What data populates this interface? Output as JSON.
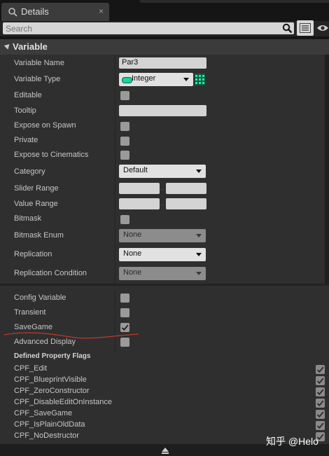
{
  "window": {
    "tab_title": "Details",
    "tab_close": "×"
  },
  "search": {
    "placeholder": "Search",
    "value": ""
  },
  "section": {
    "title": "Variable"
  },
  "rows": {
    "variable_name": {
      "label": "Variable Name",
      "value": "Par3"
    },
    "variable_type": {
      "label": "Variable Type",
      "value": "Integer",
      "pin_color": "#1fd0a0"
    },
    "editable": {
      "label": "Editable",
      "checked": false
    },
    "tooltip": {
      "label": "Tooltip",
      "value": ""
    },
    "expose_on_spawn": {
      "label": "Expose on Spawn",
      "checked": false
    },
    "private": {
      "label": "Private",
      "checked": false
    },
    "expose_to_cinematics": {
      "label": "Expose to Cinematics",
      "checked": false
    },
    "category": {
      "label": "Category",
      "value": "Default"
    },
    "slider_range": {
      "label": "Slider Range",
      "min": "",
      "max": ""
    },
    "value_range": {
      "label": "Value Range",
      "min": "",
      "max": ""
    },
    "bitmask": {
      "label": "Bitmask",
      "checked": false
    },
    "bitmask_enum": {
      "label": "Bitmask Enum",
      "value": "None"
    },
    "replication": {
      "label": "Replication",
      "value": "None"
    },
    "replication_condition": {
      "label": "Replication Condition",
      "value": "None"
    },
    "range_sep": "..",
    "config_variable": {
      "label": "Config Variable",
      "checked": false
    },
    "transient": {
      "label": "Transient",
      "checked": false
    },
    "save_game": {
      "label": "SaveGame",
      "checked": true
    },
    "advanced_display": {
      "label": "Advanced Display",
      "checked": false
    }
  },
  "flags": {
    "title": "Defined Property Flags",
    "items": [
      {
        "label": "CPF_Edit",
        "checked": true
      },
      {
        "label": "CPF_BlueprintVisible",
        "checked": true
      },
      {
        "label": "CPF_ZeroConstructor",
        "checked": true
      },
      {
        "label": "CPF_DisableEditOnInstance",
        "checked": true
      },
      {
        "label": "CPF_SaveGame",
        "checked": true
      },
      {
        "label": "CPF_IsPlainOldData",
        "checked": true
      },
      {
        "label": "CPF_NoDestructor",
        "checked": true
      }
    ]
  },
  "watermark": "知乎 @Helo",
  "icons": [
    "details-icon",
    "search-icon",
    "view-options-icon",
    "eye-icon",
    "grid-icon",
    "scroll-up-icon",
    "checkmark-icon"
  ],
  "colors": {
    "annotation_red": "#c0392b",
    "pin_green": "#1fd0a0"
  }
}
